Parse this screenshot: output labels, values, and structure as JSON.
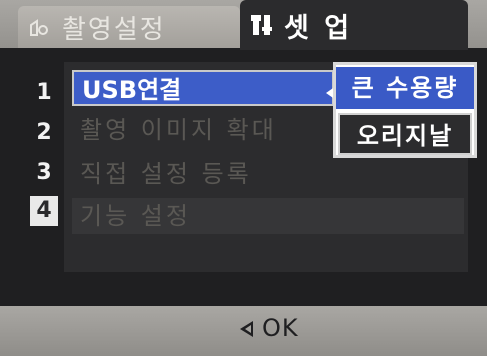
{
  "tabs": {
    "shooting": {
      "label": "촬영설정",
      "icon": "camera-icon"
    },
    "setup": {
      "label": "셋 업",
      "icon": "wrench-icon"
    }
  },
  "page_numbers": [
    "1",
    "2",
    "3",
    "4"
  ],
  "menu": {
    "items": [
      {
        "label": "USB연결"
      },
      {
        "label": "촬영 이미지 확대"
      },
      {
        "label": "직접 설정 등록"
      },
      {
        "label": "기능 설정"
      }
    ]
  },
  "popup": {
    "options": [
      "큰 수용량",
      "오리지날"
    ]
  },
  "footer": {
    "ok_label": "OK"
  },
  "colors": {
    "highlight": "#3d5dc8",
    "bar": "#a9a7a3",
    "background": "#1f1f21"
  }
}
